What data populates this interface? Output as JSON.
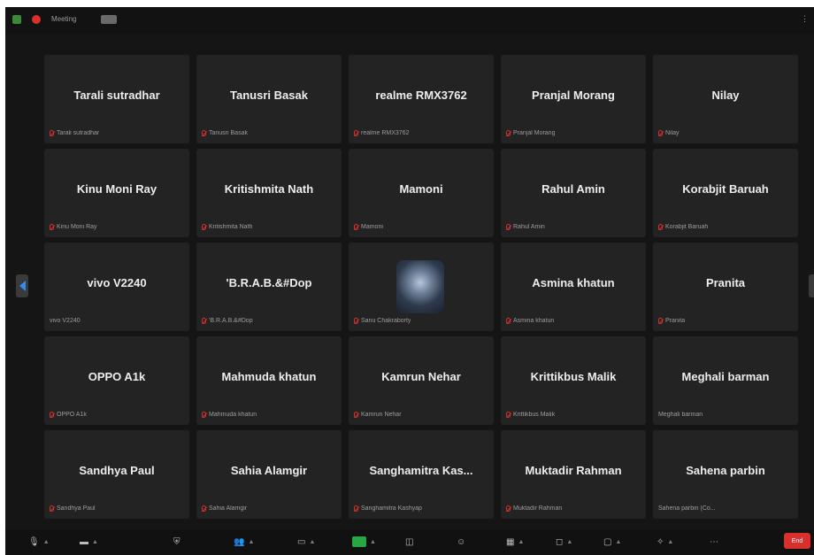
{
  "window": {
    "title": "Meeting",
    "right_control": "⋮"
  },
  "participants": [
    {
      "name": "Tarali sutradhar",
      "caption": "Tarali sutradhar",
      "muted": true
    },
    {
      "name": "Tanusri Basak",
      "caption": "Tanusri Basak",
      "muted": true
    },
    {
      "name": "realme RMX3762",
      "caption": "realme RMX3762",
      "muted": true
    },
    {
      "name": "Pranjal Morang",
      "caption": "Pranjal Morang",
      "muted": true
    },
    {
      "name": "Nilay",
      "caption": "Nilay",
      "muted": true
    },
    {
      "name": "Kinu Moni Ray",
      "caption": "Kinu Moni Ray",
      "muted": true
    },
    {
      "name": "Kritishmita Nath",
      "caption": "Kritishmita Nath",
      "muted": true
    },
    {
      "name": "Mamoni",
      "caption": "Mamoni",
      "muted": true
    },
    {
      "name": "Rahul Amin",
      "caption": "Rahul Amin",
      "muted": true
    },
    {
      "name": "Korabjit Baruah",
      "caption": "Korabjit Baruah",
      "muted": true
    },
    {
      "name": "vivo V2240",
      "caption": "vivo V2240",
      "muted": false
    },
    {
      "name": "'B.R.A.B.&#Dop",
      "caption": "'B.R.A.B.&#Dop",
      "muted": true
    },
    {
      "name": "",
      "caption": "Sanu Chakraborty",
      "muted": true,
      "has_photo": true
    },
    {
      "name": "Asmina khatun",
      "caption": "Asmina khatun",
      "muted": true
    },
    {
      "name": "Pranita",
      "caption": "Pranita",
      "muted": true
    },
    {
      "name": "OPPO A1k",
      "caption": "OPPO A1k",
      "muted": true
    },
    {
      "name": "Mahmuda khatun",
      "caption": "Mahmuda khatun",
      "muted": true
    },
    {
      "name": "Kamrun Nehar",
      "caption": "Kamrun Nehar",
      "muted": true
    },
    {
      "name": "Krittikbus Malik",
      "caption": "Krittikbus Malik",
      "muted": true
    },
    {
      "name": "Meghali barman",
      "caption": "Meghali barman",
      "muted": false
    },
    {
      "name": "Sandhya Paul",
      "caption": "Sandhya Paul",
      "muted": true
    },
    {
      "name": "Sahia Alamgir",
      "caption": "Sahia Alamgir",
      "muted": true
    },
    {
      "name": "Sanghamitra Kas...",
      "caption": "Sanghamitra Kashyap",
      "muted": true
    },
    {
      "name": "Muktadir Rahman",
      "caption": "Muktadir Rahman",
      "muted": true
    },
    {
      "name": "Sahena parbin",
      "caption": "Sahena parbin (Co...",
      "muted": false
    }
  ],
  "toolbar": {
    "end_label": "End"
  },
  "colors": {
    "background": "#151515",
    "tile": "#232323",
    "muted_icon": "#d9302c",
    "share": "#28a745",
    "nav_arrow": "#2f8ef4"
  }
}
